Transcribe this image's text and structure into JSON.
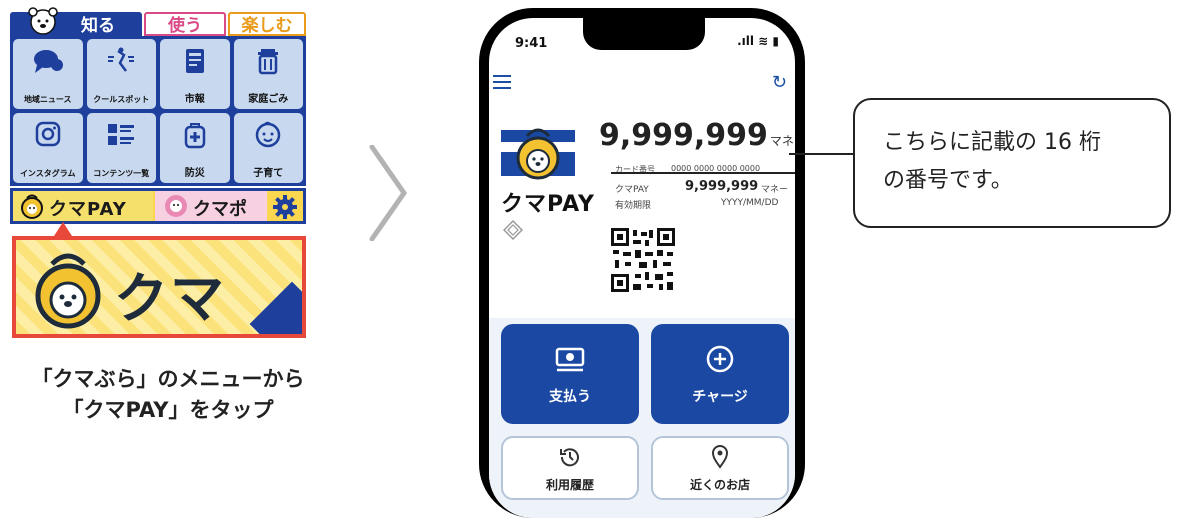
{
  "app_menu": {
    "tabs": {
      "know": "知る",
      "use": "使う",
      "enjoy": "楽しむ"
    },
    "tiles": [
      {
        "label": "地域ニュース",
        "icon": "news-bubble-icon"
      },
      {
        "label": "クールスポット",
        "icon": "cool-spot-icon"
      },
      {
        "label": "市報",
        "icon": "city-bulletin-icon"
      },
      {
        "label": "家庭ごみ",
        "icon": "trash-icon"
      },
      {
        "label": "インスタグラム",
        "icon": "instagram-icon"
      },
      {
        "label": "コンテンツ一覧",
        "icon": "list-icon"
      },
      {
        "label": "防災",
        "icon": "disaster-prevention-icon"
      },
      {
        "label": "子育て",
        "icon": "baby-icon"
      }
    ],
    "bottom_bar": {
      "pay": "クマPAY",
      "points": "クマポ"
    },
    "banner": "クマPAY",
    "caption_line1": "「クマぶら」のメニューから",
    "caption_line2": "「クマPAY」をタップ"
  },
  "phone": {
    "time": "9:41",
    "status": ".ıll ≋ ▮",
    "logo_text": "クマPAY",
    "balance": "9,999,999",
    "balance_unit": "マネー",
    "card_label": "カード番号",
    "card_number": "0000 0000 0000 0000",
    "pay_label": "クマPAY",
    "pay_value": "9,999,999",
    "pay_unit": "マネー",
    "expiry_label": "有効期限",
    "expiry_value": "YYYY/MM/DD",
    "buttons": {
      "pay": "支払う",
      "charge": "チャージ",
      "history": "利用履歴",
      "nearby": "近くのお店"
    }
  },
  "callout": {
    "line1": "こちらに記載の 16 桁",
    "line2": "の番号です。"
  },
  "colors": {
    "brand_blue": "#1e3f9c",
    "button_blue": "#1a48a3",
    "accent_red": "#e8483a",
    "yellow": "#fbd64f"
  }
}
